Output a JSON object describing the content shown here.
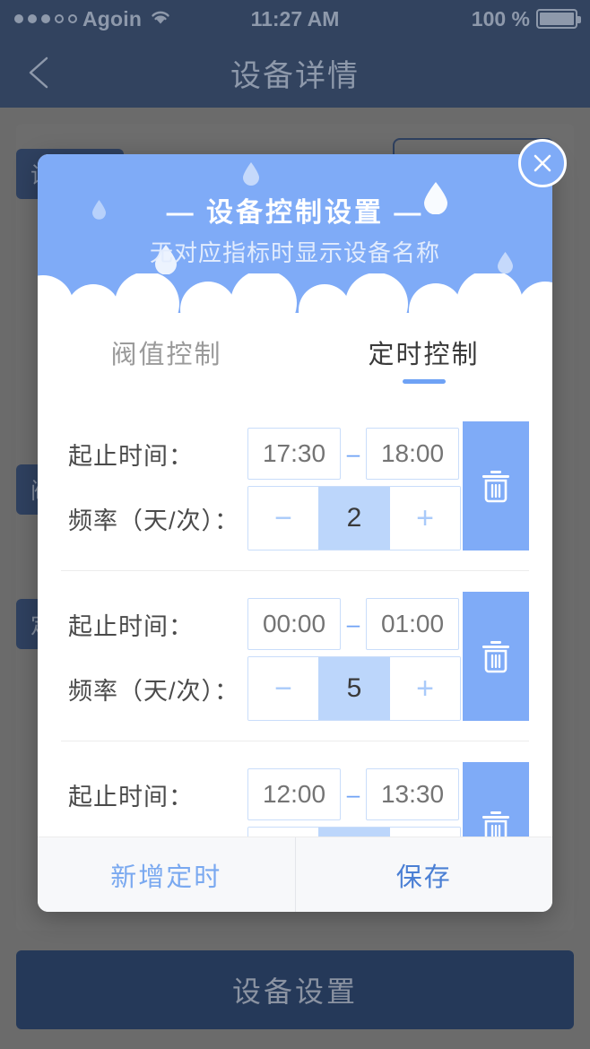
{
  "statusbar": {
    "carrier": "Agoin",
    "time": "11:27 AM",
    "battery_pct": "100 %",
    "signal_dots_filled": 3,
    "signal_dots_total": 5
  },
  "navbar": {
    "title": "设备详情",
    "back_icon": "chevron-left-icon"
  },
  "background": {
    "section_1": "设备信息",
    "section_2": "阀值控制",
    "section_3": "定时控制",
    "bottom_button": "设备设置"
  },
  "modal": {
    "title": "— 设备控制设置 —",
    "subtitle": "无对应指标时显示设备名称",
    "close_icon": "close-icon",
    "tabs": [
      {
        "label": "阀值控制",
        "active": false
      },
      {
        "label": "定时控制",
        "active": true
      }
    ],
    "labels": {
      "time_range": "起止时间：",
      "frequency": "频率（天/次）：",
      "dash": "–",
      "minus": "−",
      "plus": "+",
      "delete_icon": "trash-icon"
    },
    "schedules": [
      {
        "start": "17:30",
        "end": "18:00",
        "frequency": "2"
      },
      {
        "start": "00:00",
        "end": "01:00",
        "frequency": "5"
      },
      {
        "start": "12:00",
        "end": "13:30",
        "frequency": ""
      }
    ],
    "footer": {
      "add": "新增定时",
      "save": "保存"
    }
  },
  "colors": {
    "brand_blue": "#7fabf7",
    "light_blue": "#bcd6fb",
    "navy": "#32435f",
    "save_blue": "#4a7fd4"
  }
}
